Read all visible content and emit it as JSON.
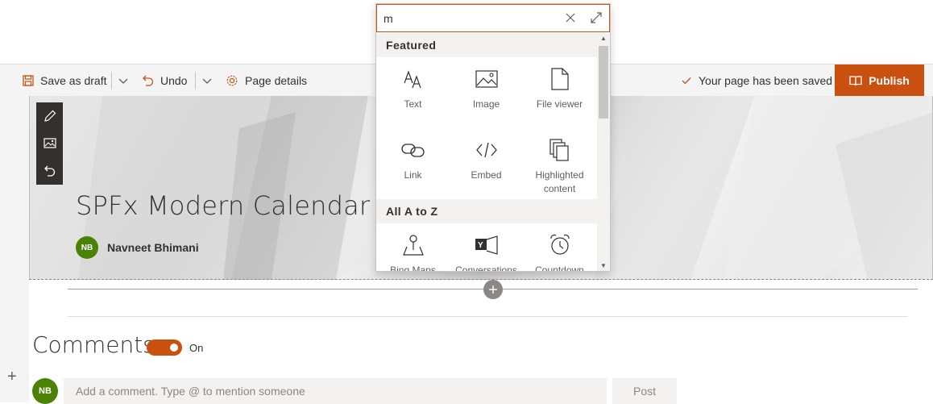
{
  "toolbar": {
    "save_draft_label": "Save as draft",
    "undo_label": "Undo",
    "page_details_label": "Page details",
    "saved_status": "Your page has been saved",
    "publish_label": "Publish"
  },
  "hero": {
    "title": "SPFx Modern Calendar",
    "author_initials": "NB",
    "author_name": "Navneet Bhimani"
  },
  "toolbox": {
    "search_value": "m",
    "sections": [
      {
        "label": "Featured",
        "items": [
          {
            "label": "Text",
            "icon": "text-icon"
          },
          {
            "label": "Image",
            "icon": "image-icon"
          },
          {
            "label": "File viewer",
            "icon": "file-viewer-icon"
          },
          {
            "label": "Link",
            "icon": "link-icon"
          },
          {
            "label": "Embed",
            "icon": "embed-icon"
          },
          {
            "label": "Highlighted content",
            "icon": "highlighted-content-icon"
          }
        ]
      },
      {
        "label": "All A to Z",
        "items": [
          {
            "label": "Bing Maps",
            "icon": "bing-maps-icon"
          },
          {
            "label": "Conversations",
            "icon": "conversations-icon"
          },
          {
            "label": "Countdown",
            "icon": "countdown-icon"
          }
        ]
      }
    ]
  },
  "comments": {
    "title": "Comments",
    "toggle_label": "On",
    "toggle_on": true,
    "avatar_initials": "NB",
    "input_placeholder": "Add a comment. Type @ to mention someone",
    "post_label": "Post"
  },
  "colors": {
    "accent": "#ca5010",
    "avatar": "#498205"
  }
}
